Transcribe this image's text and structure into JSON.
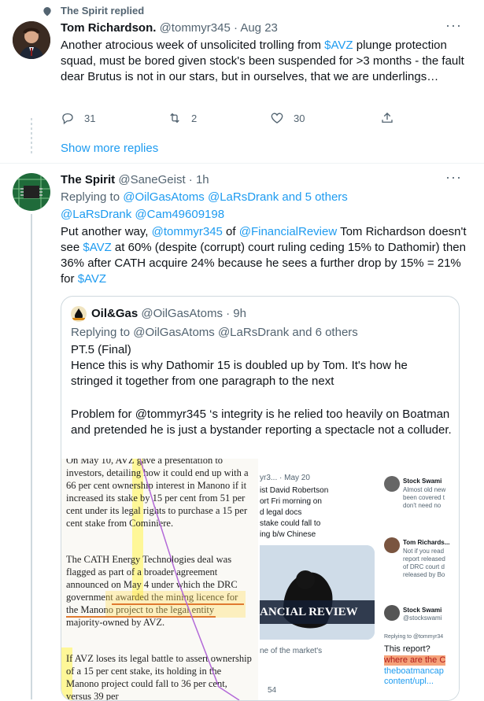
{
  "context": {
    "replied_label": "The Spirit replied"
  },
  "tweet1": {
    "name": "Tom Richardson.",
    "handle": "@tommyr345",
    "time": "· Aug 23",
    "text_a": "Another atrocious week of unsolicited trolling from ",
    "cashtag": "$AVZ",
    "text_b": " plunge protection squad, must be bored given stock's been suspended for >3 months - the fault dear Brutus is not in our stars, but in ourselves, that we are underlings…",
    "replies": "31",
    "retweets": "2",
    "likes": "30"
  },
  "show_more": "Show more replies",
  "tweet2": {
    "name": "The Spirit",
    "handle": "@SaneGeist",
    "time": "· 1h",
    "replying_prefix": "Replying to ",
    "replying_users": "@OilGasAtoms @LaRsDrank and 5 others",
    "mentions_line": "@LaRsDrank @Cam49609198",
    "t1": "Put another way, ",
    "m1": "@tommyr345",
    "t2": " of ",
    "m2": "@FinancialReview",
    "t3": "  Tom Richardson doesn't see ",
    "c1": "$AVZ",
    "t4": " at 60% (despite (corrupt) court ruling ceding 15% to Dathomir) then 36% after CATH acquire 24% because he sees a further drop by 15% = 21% for ",
    "c2": "$AVZ"
  },
  "quote": {
    "name": "Oil&Gas",
    "handle": "@OilGasAtoms",
    "time": "· 9h",
    "replying": "Replying to @OilGasAtoms @LaRsDrank and 6 others",
    "line1": "PT.5 (Final)",
    "line2": "Hence this is why Dathomir 15 is doubled up by Tom. It's how he stringed it together from one paragraph to the next",
    "line3": "Problem for @tommyr345 ‘s integrity is he relied too heavily on Boatman and pretended he is just a bystander reporting a spectacle not a colluder."
  },
  "article": {
    "p1": "On May 10, AVZ gave a presentation to investors, detailing how it could end up with a 66 per cent ownership interest in Manono if it increased its stake by 15 per cent from 51 per cent under its legal rights to purchase a 15 per cent stake from Cominiere.",
    "p2": "The CATH Energy Technologies deal was flagged as part of a broader agreement announced on May 4 under which the DRC government awarded the mining licence for the Manono project to the legal entity majority-owned by AVZ.",
    "p3": "If AVZ loses its legal battle to assert ownership of a 15 per cent stake, its holding in the Manono project could fall to 36 per cent, versus 39 per"
  },
  "collage": {
    "mid_header": "yr3... · May 20",
    "mid_text": "ist David Robertson\nort Fri morning on\nd legal docs\nstake could fall to\ning b/w Chinese",
    "mid_banner": "ANCIAL REVIEW",
    "mid_caption": "ne of the market's",
    "mid_count": "54",
    "r_name1": "Stock Swami",
    "r_text1": "Almost old new\nbeen covered t\ndon't need no",
    "r_name2": "Tom Richards...",
    "r_text2": "Not if you read\nreport released\nof DRC court d\nreleased by Bo",
    "r_name3": "Stock Swami",
    "r_handle3": "@stockswami",
    "r_replying": "Replying to @tommyr34",
    "r_q": "This report?",
    "r_hl": "where are the C",
    "r_link1": "theboatmancap",
    "r_link2": "content/upl..."
  }
}
